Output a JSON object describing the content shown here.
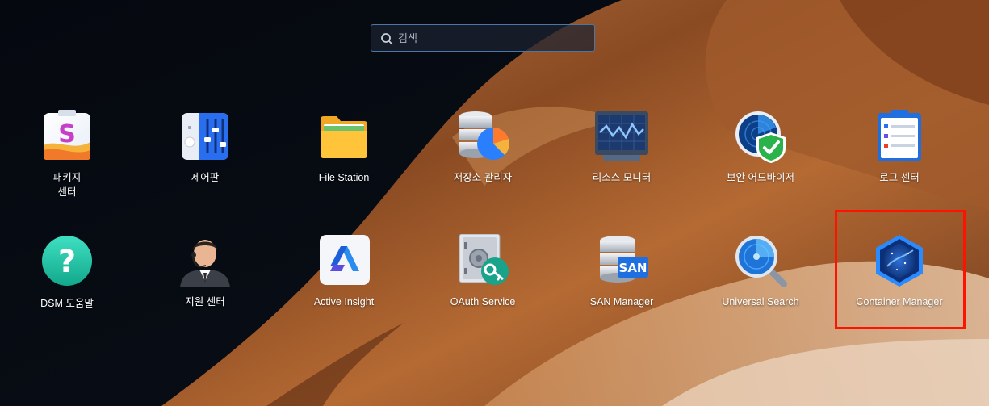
{
  "search": {
    "placeholder": "검색",
    "value": ""
  },
  "apps_row1": [
    {
      "label": "패키지\n센터",
      "icon": "package-center-icon"
    },
    {
      "label": "제어판",
      "icon": "control-panel-icon"
    },
    {
      "label": "File Station",
      "icon": "file-station-icon"
    },
    {
      "label": "저장소 관리자",
      "icon": "storage-manager-icon"
    },
    {
      "label": "리소스 모니터",
      "icon": "resource-monitor-icon"
    },
    {
      "label": "보안 어드바이저",
      "icon": "security-advisor-icon"
    },
    {
      "label": "로그 센터",
      "icon": "log-center-icon"
    }
  ],
  "apps_row2": [
    {
      "label": "DSM 도움말",
      "icon": "dsm-help-icon"
    },
    {
      "label": "지원 센터",
      "icon": "support-center-icon"
    },
    {
      "label": "Active Insight",
      "icon": "active-insight-icon"
    },
    {
      "label": "OAuth Service",
      "icon": "oauth-service-icon"
    },
    {
      "label": "SAN Manager",
      "icon": "san-manager-icon"
    },
    {
      "label": "Universal Search",
      "icon": "universal-search-icon"
    },
    {
      "label": "Container Manager",
      "icon": "container-manager-icon"
    }
  ],
  "san_badge": "SAN",
  "help_glyph": "?",
  "package_glyph": "S",
  "colors": {
    "highlight": "#ff1200",
    "search_border": "#4a76a8",
    "accent": "#2a7fff"
  }
}
